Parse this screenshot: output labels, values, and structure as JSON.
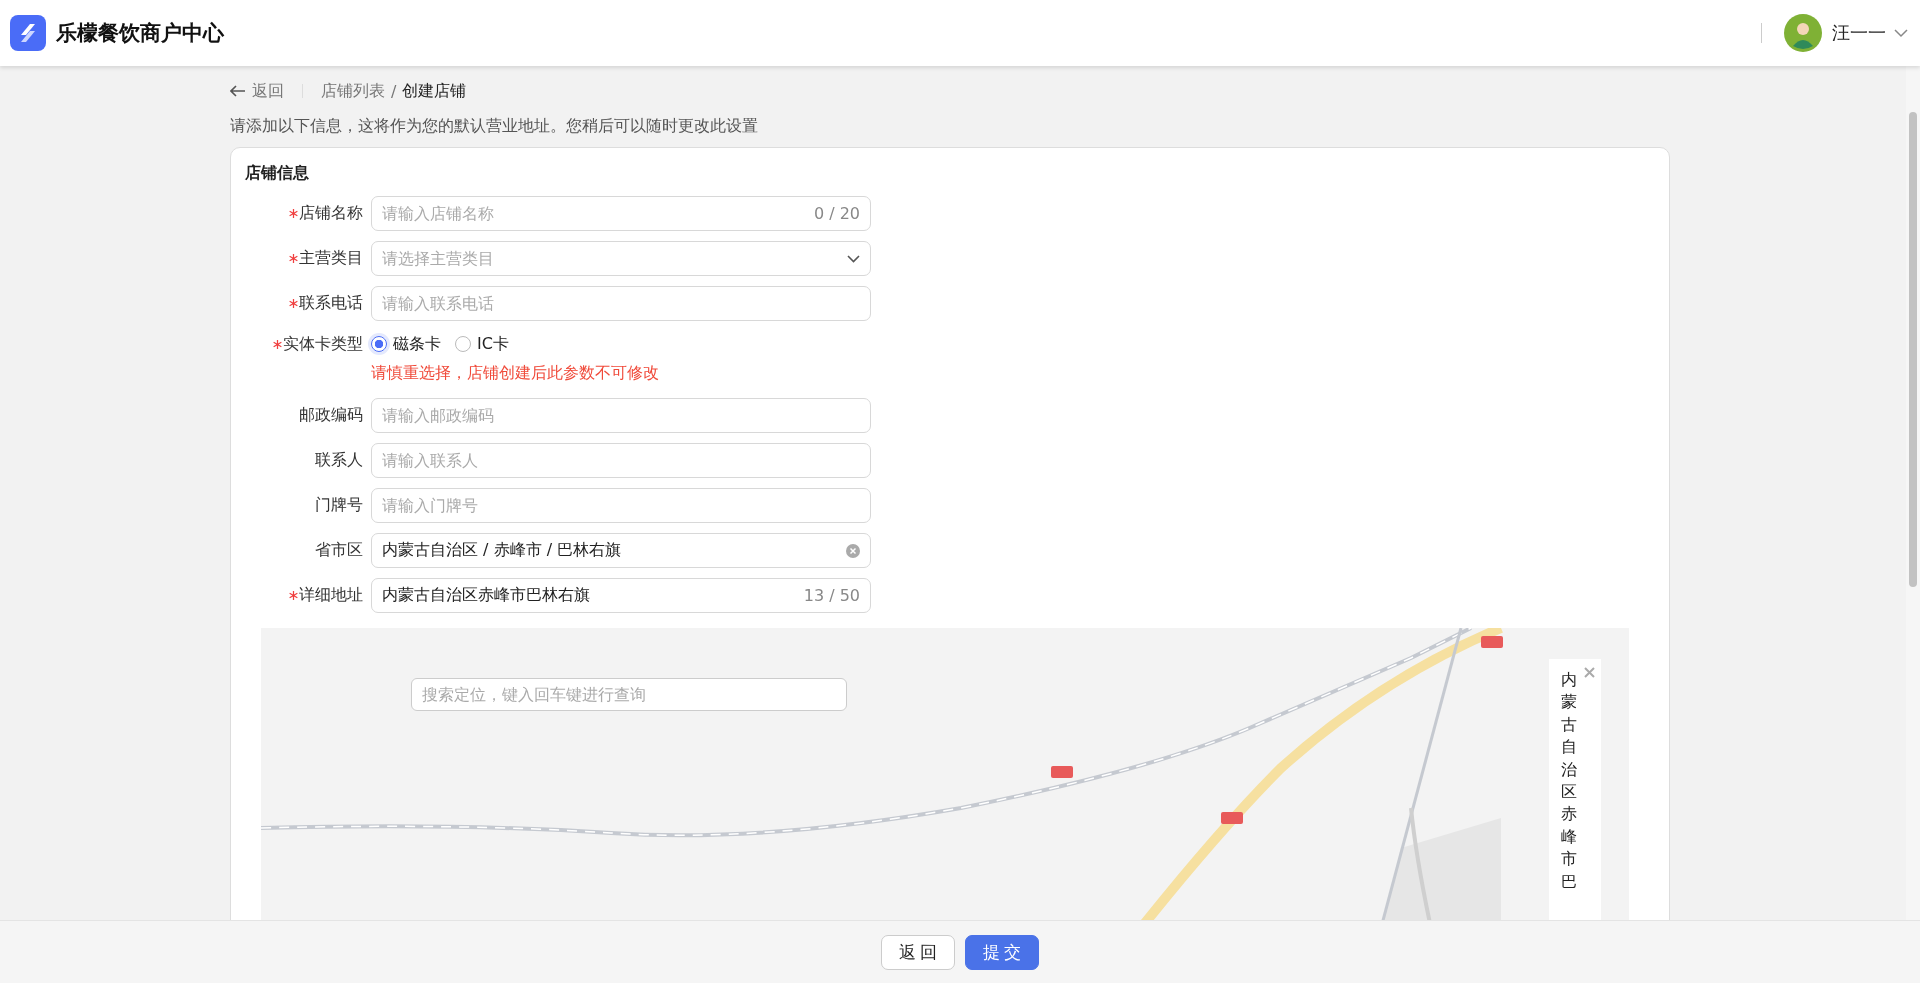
{
  "header": {
    "title": "乐檬餐饮商户中心",
    "user": "汪一一"
  },
  "breadcrumb": {
    "back": "返回",
    "separator": "/",
    "items": [
      {
        "label": "店铺列表",
        "current": false
      },
      {
        "label": "创建店铺",
        "current": true
      }
    ]
  },
  "notice": "请添加以下信息，这将作为您的默认营业地址。您稍后可以随时更改此设置",
  "card": {
    "title": "店铺信息",
    "fields": [
      {
        "kind": "input",
        "label": "店铺名称",
        "required": true,
        "placeholder": "请输入店铺名称",
        "counter": "0 / 20"
      },
      {
        "kind": "select",
        "label": "主营类目",
        "required": true,
        "placeholder": "请选择主营类目"
      },
      {
        "kind": "input",
        "label": "联系电话",
        "required": true,
        "placeholder": "请输入联系电话"
      },
      {
        "kind": "radio",
        "label": "实体卡类型",
        "required": true,
        "options": [
          {
            "label": "磁条卡",
            "selected": true
          },
          {
            "label": "IC卡",
            "selected": false
          }
        ],
        "hint": "请慎重选择，店铺创建后此参数不可修改"
      },
      {
        "kind": "input",
        "label": "邮政编码",
        "required": false,
        "placeholder": "请输入邮政编码"
      },
      {
        "kind": "input",
        "label": "联系人",
        "required": false,
        "placeholder": "请输入联系人"
      },
      {
        "kind": "input",
        "label": "门牌号",
        "required": false,
        "placeholder": "请输入门牌号"
      },
      {
        "kind": "cascader",
        "label": "省市区",
        "required": false,
        "value": "内蒙古自治区 / 赤峰市 / 巴林右旗"
      },
      {
        "kind": "input",
        "label": "详细地址",
        "required": true,
        "value": "内蒙古自治区赤峰市巴林右旗",
        "counter": "13 / 50"
      }
    ],
    "map": {
      "search_placeholder": "搜索定位，键入回车键进行查询",
      "info": "内蒙古自治区赤峰市巴"
    }
  },
  "footer": {
    "buttons": [
      {
        "label": "返回",
        "primary": false
      },
      {
        "label": "提交",
        "primary": true
      }
    ]
  }
}
